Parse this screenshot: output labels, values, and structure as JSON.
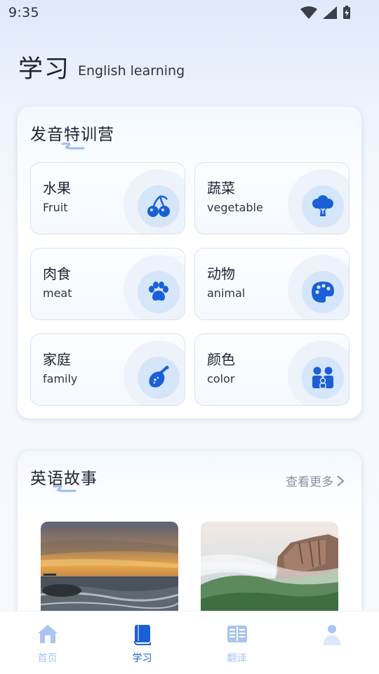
{
  "status_bar": {
    "time": "9:35"
  },
  "header": {
    "title": "学习",
    "subtitle": "English learning"
  },
  "pronunciation": {
    "title": "发音特训营",
    "topics": [
      {
        "cn": "水果",
        "en": "Fruit",
        "icon": "cherry-icon"
      },
      {
        "cn": "蔬菜",
        "en": "vegetable",
        "icon": "broccoli-icon"
      },
      {
        "cn": "肉食",
        "en": "meat",
        "icon": "paw-icon"
      },
      {
        "cn": "动物",
        "en": "animal",
        "icon": "palette-icon"
      },
      {
        "cn": "家庭",
        "en": "family",
        "icon": "drumstick-icon"
      },
      {
        "cn": "颜色",
        "en": "color",
        "icon": "people-icon"
      }
    ]
  },
  "stories": {
    "title": "英语故事",
    "more_label": "查看更多",
    "items": [
      {
        "image": "sunset-sea-image"
      },
      {
        "image": "misty-mountain-image"
      }
    ]
  },
  "bottom_nav": {
    "items": [
      {
        "label": "首页",
        "icon": "home-icon",
        "active": false
      },
      {
        "label": "学习",
        "icon": "book-icon",
        "active": true
      },
      {
        "label": "翻译",
        "icon": "translate-icon",
        "active": false
      },
      {
        "label": "",
        "icon": "profile-icon",
        "active": false
      }
    ]
  },
  "colors": {
    "accent": "#1b5fd6",
    "icon_bg": "#d5e6fb",
    "inactive_nav": "#a9c5f0"
  }
}
